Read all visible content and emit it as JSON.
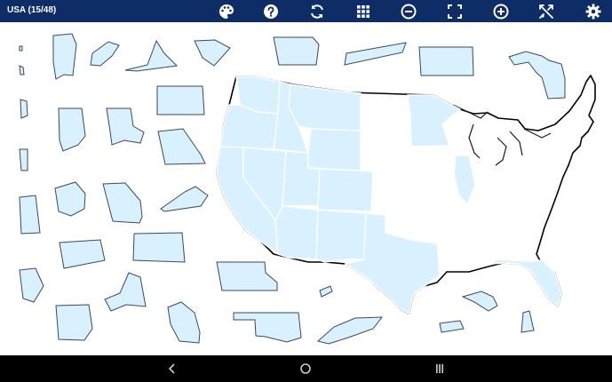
{
  "header": {
    "title": "USA (15/48)",
    "toolbar": [
      {
        "name": "palette-button",
        "icon": "palette-icon"
      },
      {
        "name": "help-button",
        "icon": "question-icon"
      },
      {
        "name": "restart-button",
        "icon": "refresh-icon"
      },
      {
        "name": "grid-button",
        "icon": "grid-icon"
      },
      {
        "name": "zoom-out-button",
        "icon": "zoom-out-icon"
      },
      {
        "name": "fit-screen-button",
        "icon": "fullscreen-icon"
      },
      {
        "name": "zoom-in-button",
        "icon": "zoom-in-icon"
      },
      {
        "name": "shuffle-button",
        "icon": "shuffle-icon"
      },
      {
        "name": "settings-button",
        "icon": "gear-icon"
      }
    ]
  },
  "game": {
    "placed_count": 15,
    "total_count": 48,
    "piece_color": "#d9f0ff",
    "header_color": "#0e2c66"
  },
  "navigation": {
    "buttons": [
      "back-icon",
      "home-icon",
      "recents-icon"
    ]
  }
}
